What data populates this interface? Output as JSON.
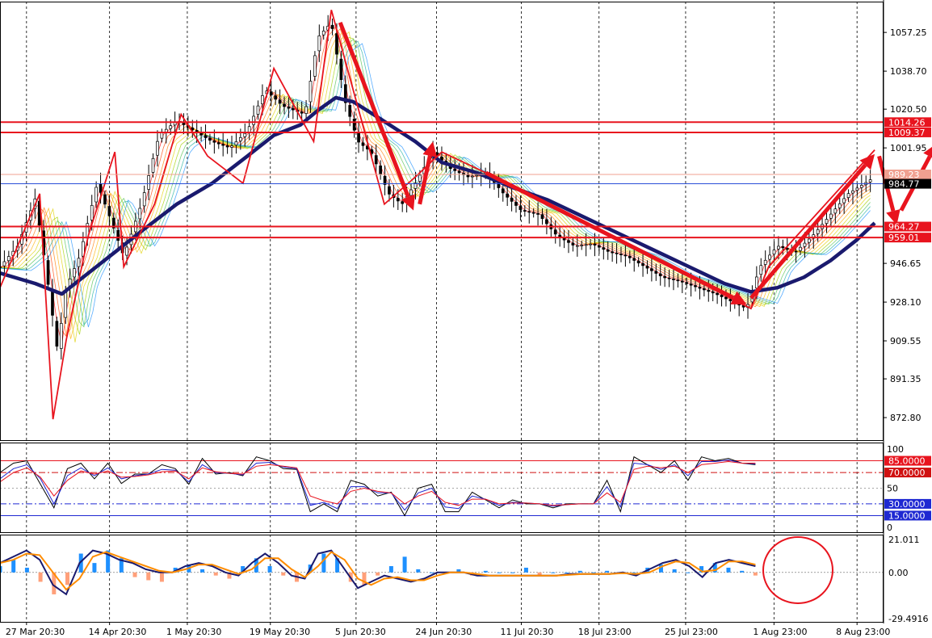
{
  "chart_data": [
    {
      "type": "candlestick",
      "panel": "price",
      "ylim": [
        862,
        1072
      ],
      "yticks": [
        1057.25,
        1038.7,
        1020.5,
        1001.95,
        946.65,
        928.1,
        909.55,
        891.35,
        872.8
      ],
      "ytick_labels": [
        "1057.25",
        "1038.70",
        "1020.50",
        "1001.95",
        "946.65",
        "928.10",
        "909.55",
        "891.35",
        "872.80"
      ],
      "x_tick_labels": [
        "27 Mar 20:30",
        "14 Apr 20:30",
        "1 May 20:30",
        "19 May 20:30",
        "5 Jun 20:30",
        "24 Jun 20:30",
        "11 Jul 20:30",
        "18 Jul 23:00",
        "25 Jul 23:00",
        "1 Aug 23:00",
        "8 Aug 23:00"
      ],
      "x_tick_fracs": [
        0.03,
        0.124,
        0.212,
        0.306,
        0.403,
        0.494,
        0.59,
        0.678,
        0.776,
        0.876,
        0.97
      ],
      "grid": true,
      "horizontal_levels": [
        {
          "value": 1014.26,
          "label": "1014.26",
          "color": "#e8141e"
        },
        {
          "value": 1009.37,
          "label": "1009.37",
          "color": "#e8141e"
        },
        {
          "value": 989.23,
          "label": "989.23",
          "color": "#f0a090"
        },
        {
          "value": 984.77,
          "label": "984.77",
          "color": "#000000"
        },
        {
          "value": 964.27,
          "label": "964.27",
          "color": "#e8141e"
        },
        {
          "value": 959.01,
          "label": "959.01",
          "color": "#e8141e"
        }
      ],
      "price_path": [
        [
          0.0,
          945
        ],
        [
          0.02,
          955
        ],
        [
          0.04,
          978
        ],
        [
          0.055,
          935
        ],
        [
          0.065,
          905
        ],
        [
          0.075,
          935
        ],
        [
          0.09,
          950
        ],
        [
          0.11,
          985
        ],
        [
          0.125,
          968
        ],
        [
          0.14,
          950
        ],
        [
          0.16,
          975
        ],
        [
          0.18,
          1008
        ],
        [
          0.2,
          1015
        ],
        [
          0.22,
          1010
        ],
        [
          0.24,
          1005
        ],
        [
          0.26,
          1002
        ],
        [
          0.28,
          1010
        ],
        [
          0.3,
          1030
        ],
        [
          0.32,
          1022
        ],
        [
          0.345,
          1018
        ],
        [
          0.36,
          1055
        ],
        [
          0.375,
          1062
        ],
        [
          0.39,
          1025
        ],
        [
          0.405,
          1005
        ],
        [
          0.42,
          1000
        ],
        [
          0.44,
          980
        ],
        [
          0.455,
          975
        ],
        [
          0.47,
          985
        ],
        [
          0.49,
          1000
        ],
        [
          0.51,
          992
        ],
        [
          0.53,
          988
        ],
        [
          0.55,
          990
        ],
        [
          0.57,
          980
        ],
        [
          0.59,
          972
        ],
        [
          0.61,
          970
        ],
        [
          0.63,
          960
        ],
        [
          0.65,
          955
        ],
        [
          0.67,
          956
        ],
        [
          0.69,
          952
        ],
        [
          0.71,
          950
        ],
        [
          0.73,
          945
        ],
        [
          0.75,
          940
        ],
        [
          0.77,
          938
        ],
        [
          0.79,
          935
        ],
        [
          0.81,
          932
        ],
        [
          0.83,
          928
        ],
        [
          0.845,
          925
        ],
        [
          0.86,
          945
        ],
        [
          0.88,
          955
        ],
        [
          0.9,
          952
        ],
        [
          0.92,
          960
        ],
        [
          0.94,
          970
        ],
        [
          0.96,
          980
        ],
        [
          0.975,
          984
        ],
        [
          0.99,
          988
        ]
      ],
      "ma_slow": [
        [
          0.0,
          942
        ],
        [
          0.04,
          937
        ],
        [
          0.07,
          932
        ],
        [
          0.1,
          942
        ],
        [
          0.13,
          952
        ],
        [
          0.16,
          962
        ],
        [
          0.2,
          975
        ],
        [
          0.24,
          985
        ],
        [
          0.28,
          998
        ],
        [
          0.31,
          1008
        ],
        [
          0.34,
          1013
        ],
        [
          0.36,
          1020
        ],
        [
          0.38,
          1026
        ],
        [
          0.4,
          1024
        ],
        [
          0.43,
          1016
        ],
        [
          0.47,
          1005
        ],
        [
          0.5,
          995
        ],
        [
          0.54,
          990
        ],
        [
          0.58,
          983
        ],
        [
          0.62,
          977
        ],
        [
          0.66,
          969
        ],
        [
          0.7,
          961
        ],
        [
          0.74,
          953
        ],
        [
          0.78,
          945
        ],
        [
          0.82,
          937
        ],
        [
          0.85,
          933
        ],
        [
          0.88,
          935
        ],
        [
          0.91,
          940
        ],
        [
          0.94,
          948
        ],
        [
          0.97,
          958
        ],
        [
          0.99,
          966
        ]
      ],
      "zigzag": [
        [
          0.0,
          935
        ],
        [
          0.045,
          980
        ],
        [
          0.06,
          872
        ],
        [
          0.075,
          910
        ],
        [
          0.1,
          960
        ],
        [
          0.13,
          1000
        ],
        [
          0.14,
          945
        ],
        [
          0.175,
          975
        ],
        [
          0.205,
          1018
        ],
        [
          0.235,
          998
        ],
        [
          0.275,
          985
        ],
        [
          0.31,
          1040
        ],
        [
          0.355,
          1005
        ],
        [
          0.375,
          1068
        ],
        [
          0.435,
          975
        ],
        [
          0.47,
          988
        ],
        [
          0.5,
          1000
        ],
        [
          0.56,
          988
        ],
        [
          0.85,
          925
        ],
        [
          0.87,
          945
        ],
        [
          0.99,
          1001
        ]
      ],
      "arrows": [
        [
          [
            0.385,
            1062
          ],
          [
            0.468,
            972
          ]
        ],
        [
          [
            0.475,
            975
          ],
          [
            0.49,
            1005
          ]
        ],
        [
          [
            0.55,
            990
          ],
          [
            0.845,
            927
          ]
        ],
        [
          [
            0.85,
            930
          ],
          [
            0.99,
            999
          ]
        ],
        [
          [
            0.995,
            998
          ],
          [
            1.015,
            965
          ]
        ],
        [
          [
            1.02,
            972
          ],
          [
            1.06,
            1004
          ]
        ]
      ]
    },
    {
      "type": "line",
      "panel": "stochastic",
      "ylim": [
        0,
        100
      ],
      "ytick_labels": [
        "100",
        "50",
        "0"
      ],
      "levels": [
        {
          "value": 85,
          "label": "85.0000",
          "color": "#e8141e",
          "style": "solid"
        },
        {
          "value": 70,
          "label": "70.0000",
          "color": "#d01010",
          "style": "dashdot"
        },
        {
          "value": 30,
          "label": "30.0000",
          "color": "#1e28d2",
          "style": "dashdot"
        },
        {
          "value": 15,
          "label": "15.0000",
          "color": "#1e28d2",
          "style": "solid"
        }
      ],
      "series": [
        {
          "color": "#000000",
          "values": [
            70,
            82,
            85,
            55,
            25,
            75,
            82,
            62,
            82,
            56,
            68,
            68,
            80,
            75,
            55,
            88,
            68,
            70,
            66,
            90,
            85,
            75,
            74,
            20,
            30,
            20,
            60,
            55,
            40,
            45,
            15,
            50,
            55,
            20,
            20,
            45,
            35,
            25,
            35,
            30,
            30,
            25,
            30,
            30,
            30,
            60,
            20,
            90,
            80,
            70,
            85,
            60,
            90,
            85,
            88,
            82,
            80
          ]
        },
        {
          "color": "#1e28d2",
          "values": [
            62,
            75,
            80,
            62,
            30,
            66,
            76,
            66,
            76,
            62,
            66,
            68,
            74,
            73,
            58,
            80,
            70,
            69,
            67,
            82,
            83,
            77,
            75,
            28,
            32,
            24,
            52,
            52,
            44,
            44,
            22,
            44,
            50,
            26,
            24,
            40,
            36,
            28,
            32,
            31,
            30,
            27,
            29,
            30,
            30,
            52,
            26,
            82,
            80,
            74,
            80,
            66,
            84,
            84,
            86,
            82,
            81
          ]
        },
        {
          "color": "#e8141e",
          "values": [
            58,
            70,
            76,
            64,
            40,
            60,
            72,
            68,
            72,
            64,
            65,
            67,
            71,
            72,
            62,
            76,
            71,
            69,
            68,
            78,
            80,
            78,
            76,
            40,
            34,
            30,
            46,
            50,
            46,
            44,
            30,
            40,
            46,
            32,
            28,
            36,
            36,
            30,
            31,
            31,
            30,
            28,
            29,
            30,
            30,
            44,
            32,
            74,
            78,
            76,
            78,
            70,
            80,
            82,
            84,
            82,
            82
          ]
        }
      ]
    },
    {
      "type": "bar",
      "panel": "macd",
      "ylim": [
        -29.4916,
        21.011
      ],
      "ytick_labels": [
        "21.011",
        "0.00",
        "-29.4916"
      ],
      "histogram": [
        4,
        8,
        3,
        -6,
        -14,
        -8,
        12,
        6,
        14,
        9,
        -3,
        -5,
        -6,
        3,
        5,
        2,
        -2,
        -4,
        4,
        9,
        4,
        -2,
        -6,
        5,
        12,
        9,
        -6,
        -8,
        -2,
        4,
        10,
        2,
        0,
        0,
        2,
        -2,
        1,
        0,
        0,
        3,
        -2,
        0,
        0,
        1,
        0,
        1,
        0,
        0,
        3,
        5,
        2,
        0,
        4,
        6,
        3,
        1,
        -2
      ],
      "macd_line": [
        6,
        10,
        14,
        8,
        -8,
        -14,
        6,
        14,
        12,
        8,
        6,
        2,
        0,
        0,
        4,
        6,
        4,
        0,
        -2,
        6,
        12,
        6,
        -2,
        -4,
        12,
        14,
        2,
        -10,
        -6,
        -2,
        -4,
        -6,
        -4,
        0,
        0,
        0,
        -2,
        -2,
        -2,
        -2,
        -2,
        -2,
        -2,
        -1,
        -1,
        -1,
        -1,
        0,
        -2,
        2,
        6,
        8,
        4,
        -3,
        6,
        8,
        6,
        4
      ]
    }
  ]
}
